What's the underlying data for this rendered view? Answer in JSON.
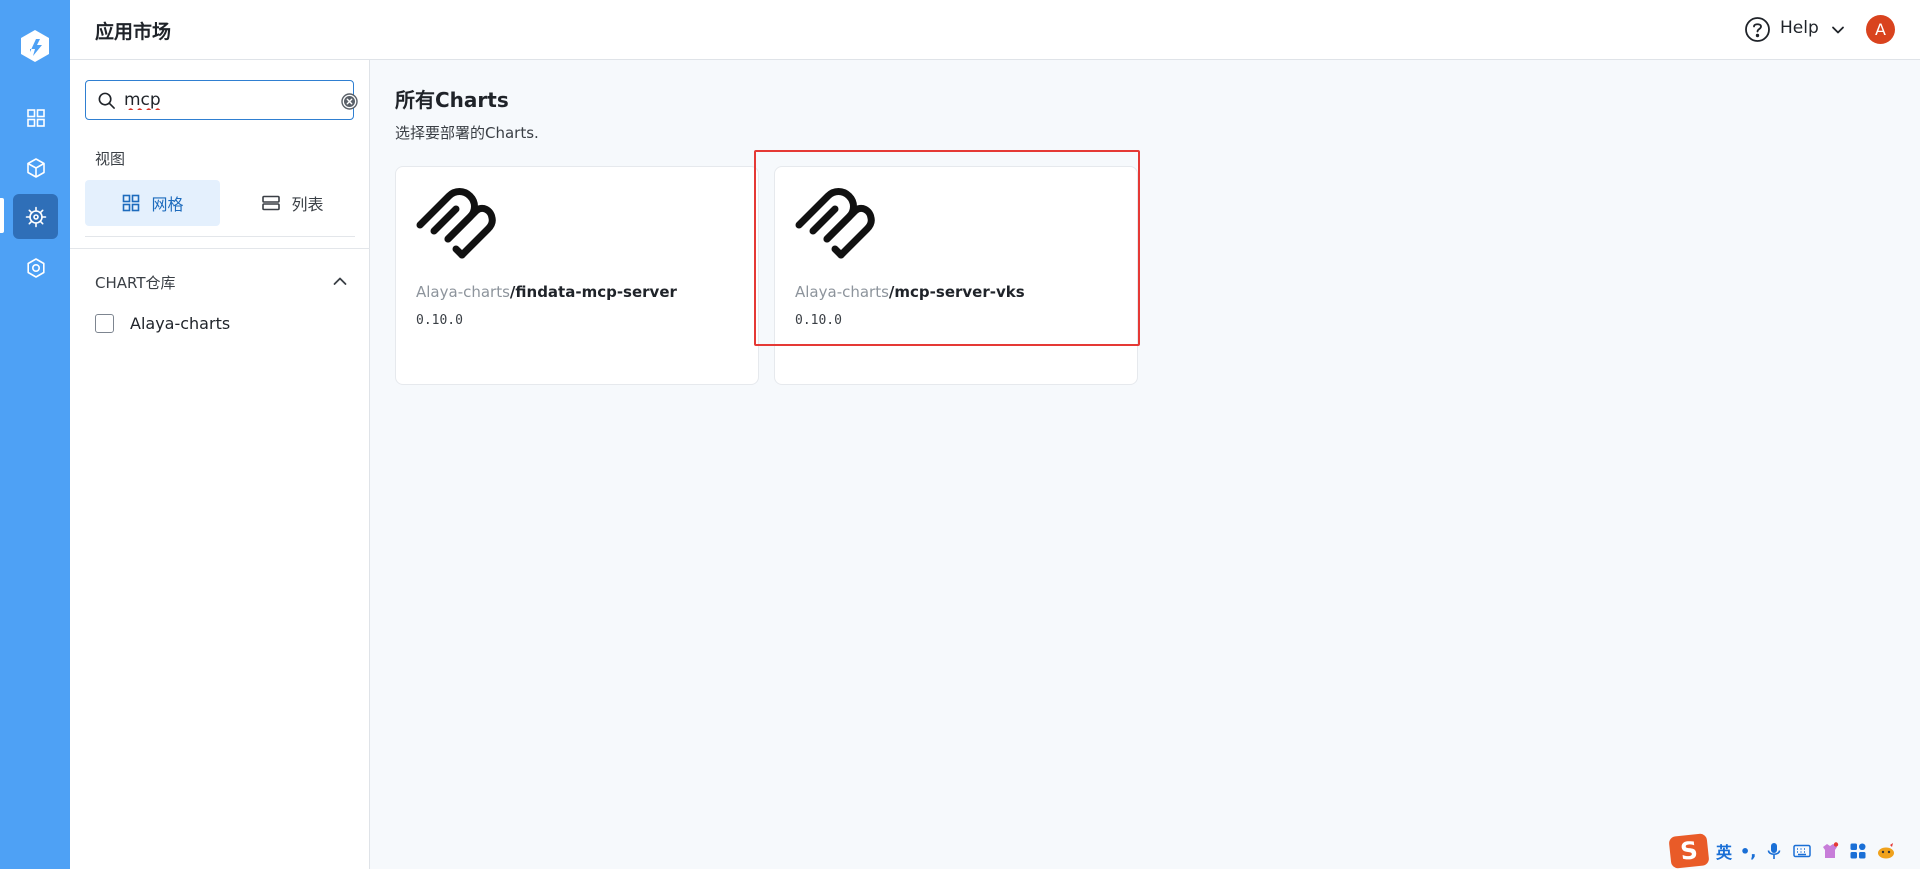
{
  "header": {
    "title": "应用市场",
    "help_label": "Help",
    "avatar_letter": "A"
  },
  "search": {
    "value": "mcp"
  },
  "view": {
    "label": "视图",
    "grid_label": "网格",
    "list_label": "列表",
    "selected": "grid"
  },
  "repo_filter": {
    "label": "CHART仓库",
    "items": [
      {
        "label": "Alaya-charts",
        "checked": false
      }
    ]
  },
  "main": {
    "heading": "所有Charts",
    "subheading": "选择要部署的Charts.",
    "cards": [
      {
        "repo": "Alaya-charts",
        "name": "/findata-mcp-server",
        "version": "0.10.0"
      },
      {
        "repo": "Alaya-charts",
        "name": "/mcp-server-vks",
        "version": "0.10.0"
      }
    ]
  },
  "ime": {
    "logo": "S",
    "mode": "英",
    "punct": "•,"
  },
  "colors": {
    "rail": "#4ea1f5",
    "rail_active": "#2f6fb8",
    "accent": "#2f7fd1",
    "avatar": "#d9431e",
    "highlight": "#e53935"
  }
}
